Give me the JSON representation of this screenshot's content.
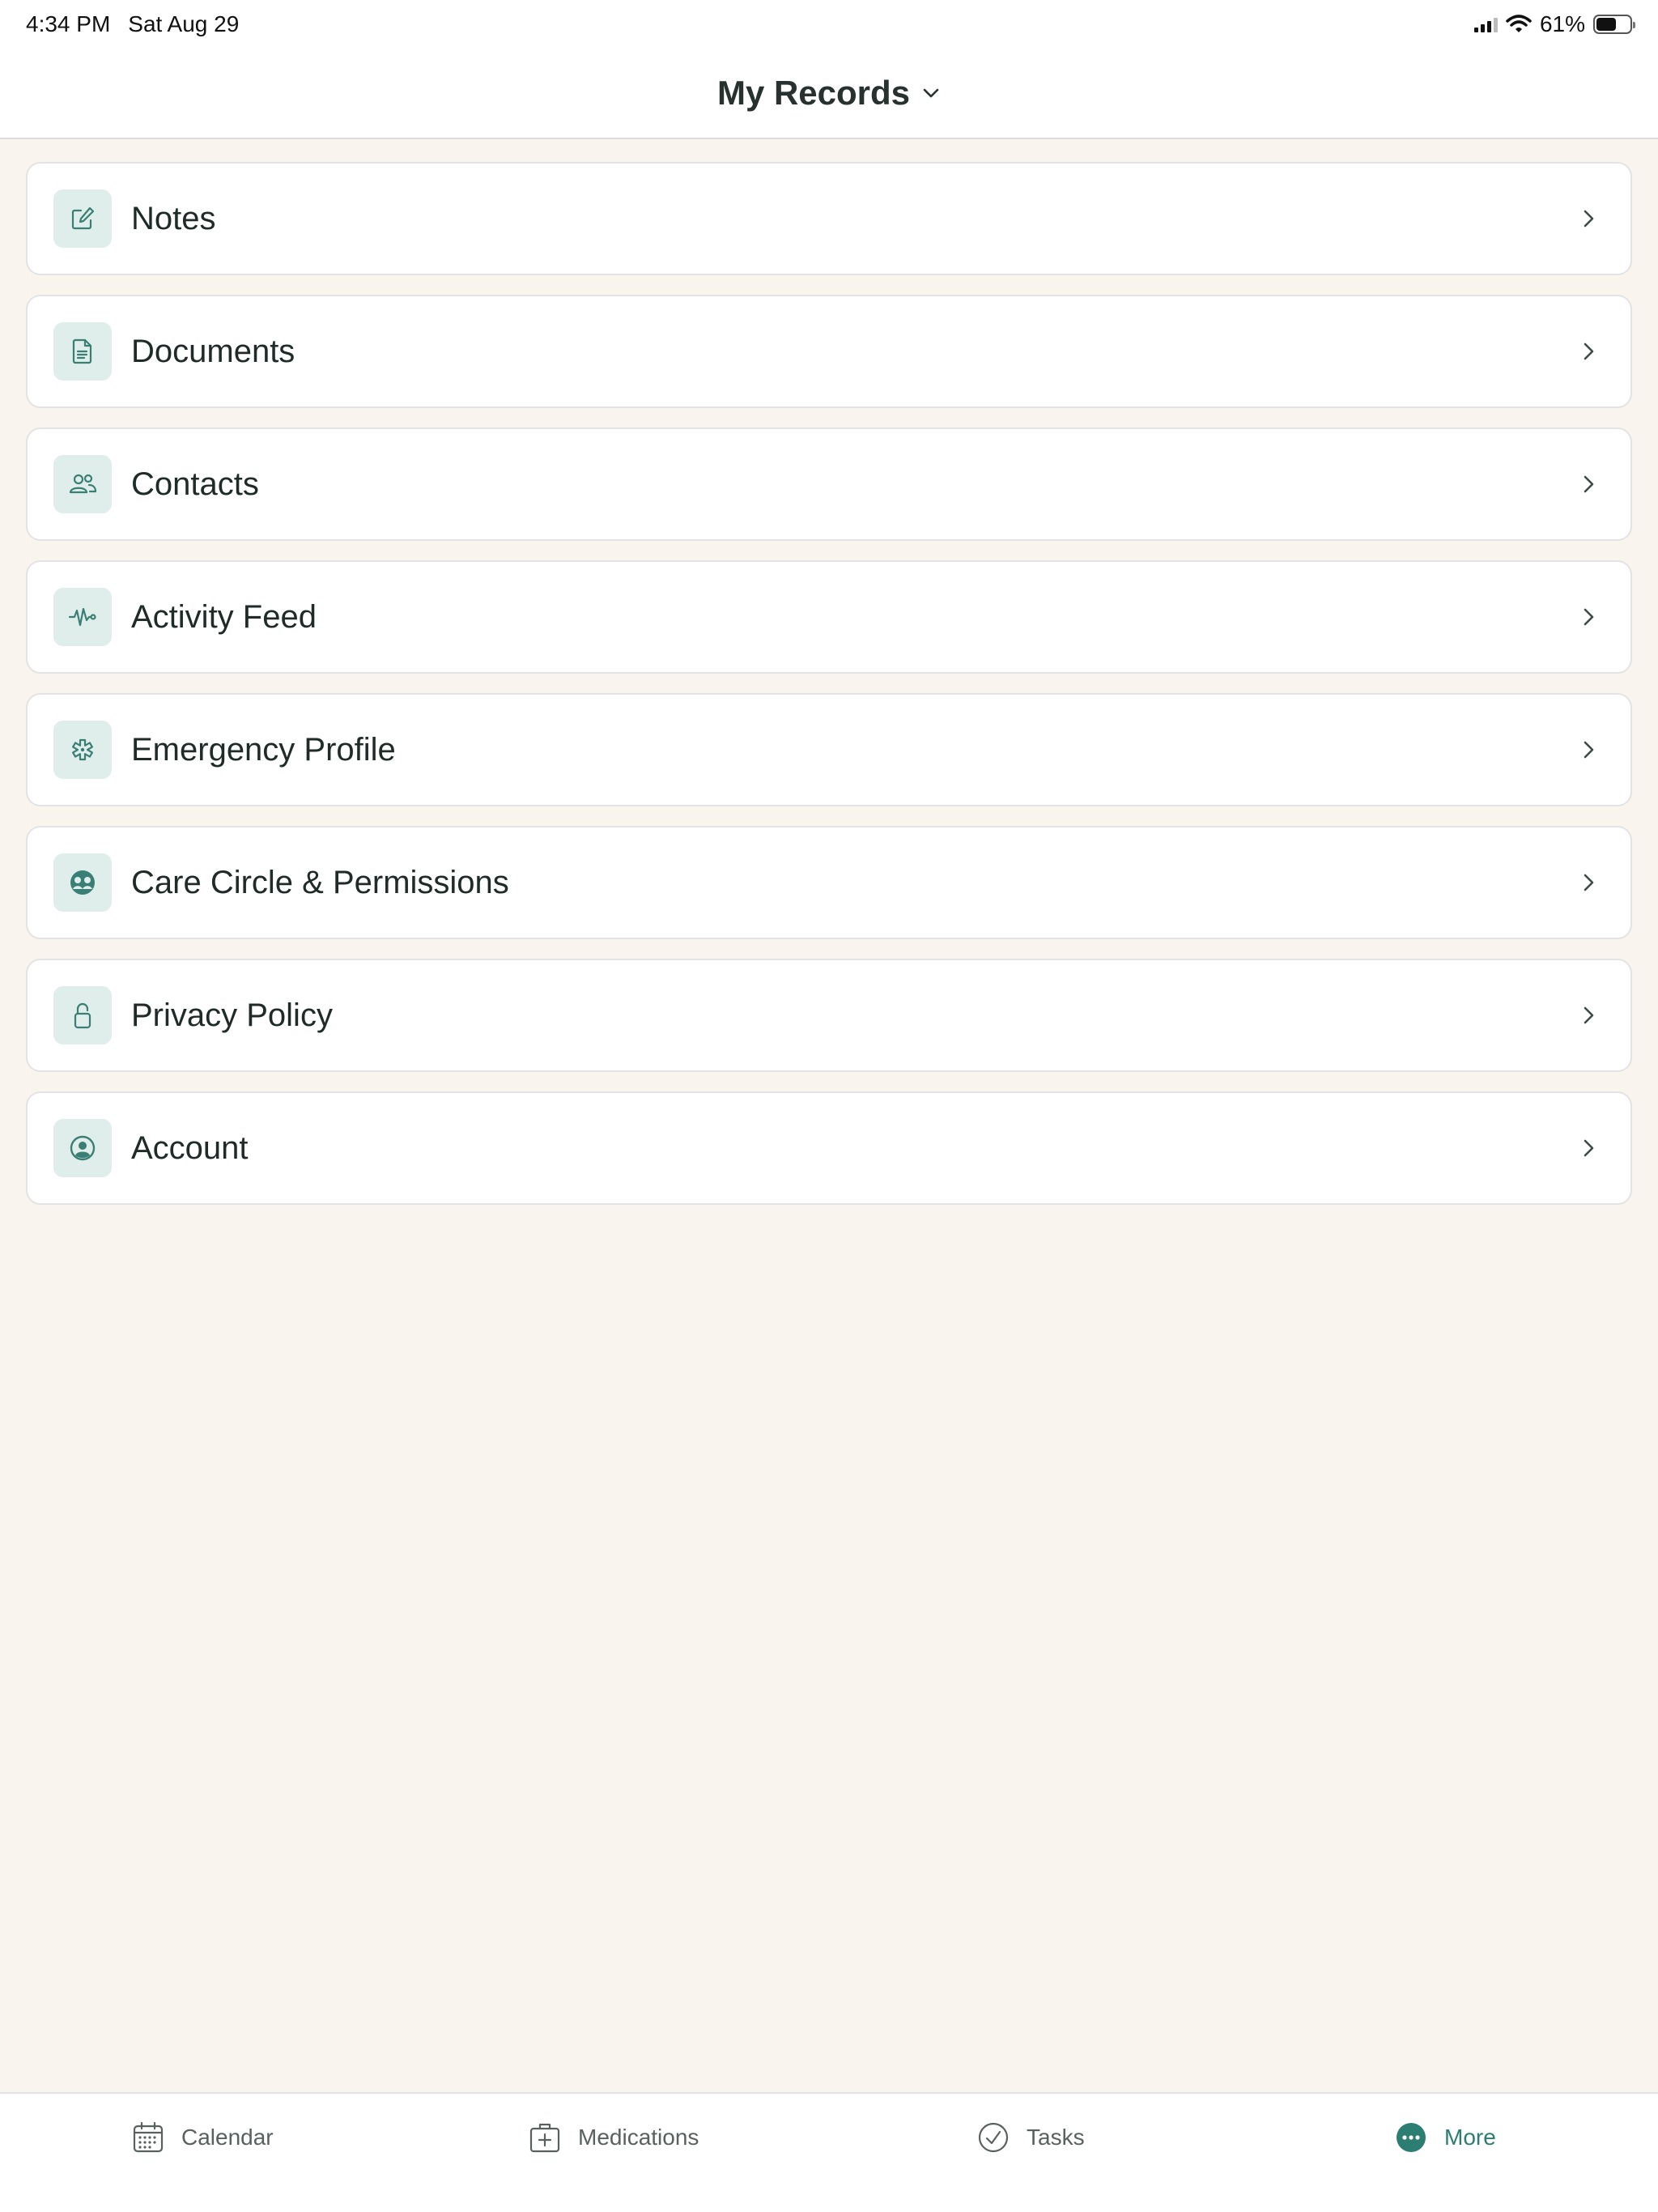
{
  "status_bar": {
    "time": "4:34 PM",
    "date": "Sat Aug 29",
    "battery": "61%",
    "battery_level": 0.61
  },
  "header": {
    "title": "My Records"
  },
  "menu": {
    "items": [
      {
        "label": "Notes",
        "icon": "edit-note-icon"
      },
      {
        "label": "Documents",
        "icon": "document-icon"
      },
      {
        "label": "Contacts",
        "icon": "people-icon"
      },
      {
        "label": "Activity Feed",
        "icon": "activity-icon"
      },
      {
        "label": "Emergency Profile",
        "icon": "medical-star-icon"
      },
      {
        "label": "Care Circle & Permissions",
        "icon": "care-circle-icon"
      },
      {
        "label": "Privacy Policy",
        "icon": "lock-icon"
      },
      {
        "label": "Account",
        "icon": "account-circle-icon"
      }
    ]
  },
  "tabbar": {
    "tabs": [
      {
        "label": "Calendar",
        "icon": "calendar-icon",
        "active": false
      },
      {
        "label": "Medications",
        "icon": "medication-box-icon",
        "active": false
      },
      {
        "label": "Tasks",
        "icon": "check-circle-icon",
        "active": false
      },
      {
        "label": "More",
        "icon": "more-dots-icon",
        "active": true
      }
    ]
  },
  "colors": {
    "accent": "#2c7d72",
    "icon_bg": "#dfeeea",
    "background": "#f9f4ee"
  }
}
